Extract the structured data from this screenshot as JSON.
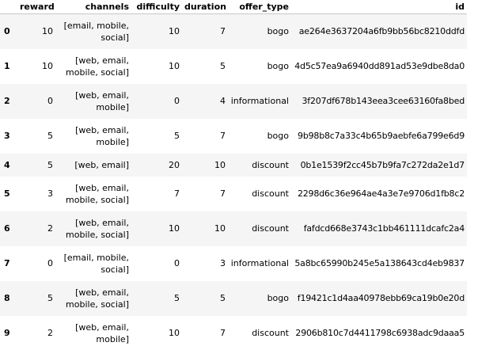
{
  "table": {
    "columns": [
      "",
      "reward",
      "channels",
      "difficulty",
      "duration",
      "offer_type",
      "id"
    ],
    "rows": [
      {
        "index": "0",
        "reward": "10",
        "channels_line1": "[email, mobile,",
        "channels_line2": "social]",
        "difficulty": "10",
        "duration": "7",
        "offer_type": "bogo",
        "id": "ae264e3637204a6fb9bb56bc8210ddfd"
      },
      {
        "index": "1",
        "reward": "10",
        "channels_line1": "[web, email,",
        "channels_line2": "mobile, social]",
        "difficulty": "10",
        "duration": "5",
        "offer_type": "bogo",
        "id": "4d5c57ea9a6940dd891ad53e9dbe8da0"
      },
      {
        "index": "2",
        "reward": "0",
        "channels_line1": "[web, email,",
        "channels_line2": "mobile]",
        "difficulty": "0",
        "duration": "4",
        "offer_type": "informational",
        "id": "3f207df678b143eea3cee63160fa8bed"
      },
      {
        "index": "3",
        "reward": "5",
        "channels_line1": "[web, email,",
        "channels_line2": "mobile]",
        "difficulty": "5",
        "duration": "7",
        "offer_type": "bogo",
        "id": "9b98b8c7a33c4b65b9aebfe6a799e6d9"
      },
      {
        "index": "4",
        "reward": "5",
        "channels_line1": "[web, email]",
        "channels_line2": "",
        "difficulty": "20",
        "duration": "10",
        "offer_type": "discount",
        "id": "0b1e1539f2cc45b7b9fa7c272da2e1d7"
      },
      {
        "index": "5",
        "reward": "3",
        "channels_line1": "[web, email,",
        "channels_line2": "mobile, social]",
        "difficulty": "7",
        "duration": "7",
        "offer_type": "discount",
        "id": "2298d6c36e964ae4a3e7e9706d1fb8c2"
      },
      {
        "index": "6",
        "reward": "2",
        "channels_line1": "[web, email,",
        "channels_line2": "mobile, social]",
        "difficulty": "10",
        "duration": "10",
        "offer_type": "discount",
        "id": "fafdcd668e3743c1bb461111dcafc2a4"
      },
      {
        "index": "7",
        "reward": "0",
        "channels_line1": "[email, mobile,",
        "channels_line2": "social]",
        "difficulty": "0",
        "duration": "3",
        "offer_type": "informational",
        "id": "5a8bc65990b245e5a138643cd4eb9837"
      },
      {
        "index": "8",
        "reward": "5",
        "channels_line1": "[web, email,",
        "channels_line2": "mobile, social]",
        "difficulty": "5",
        "duration": "5",
        "offer_type": "bogo",
        "id": "f19421c1d4aa40978ebb69ca19b0e20d"
      },
      {
        "index": "9",
        "reward": "2",
        "channels_line1": "[web, email,",
        "channels_line2": "mobile]",
        "difficulty": "10",
        "duration": "7",
        "offer_type": "discount",
        "id": "2906b810c7d4411798c6938adc9daaa5"
      }
    ]
  }
}
